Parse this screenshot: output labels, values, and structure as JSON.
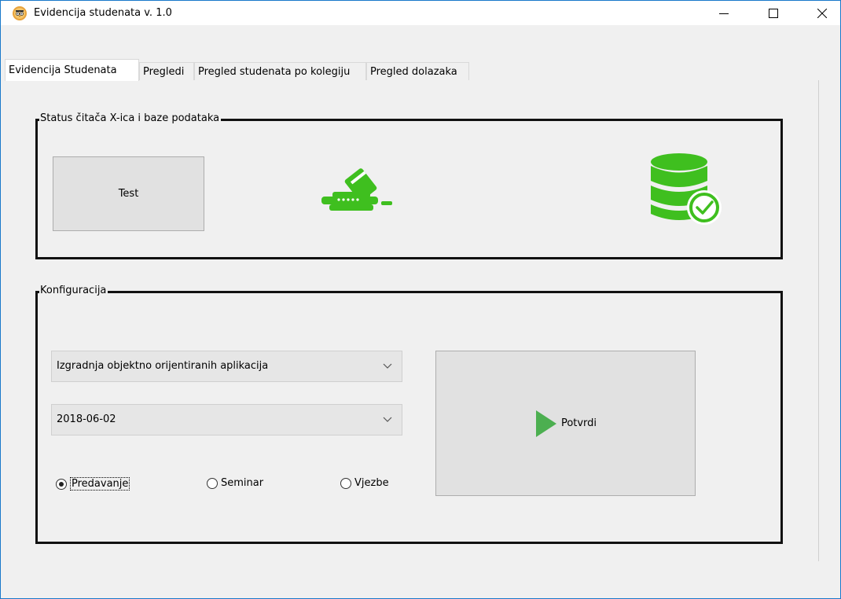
{
  "window": {
    "title": "Evidencija studenata v. 1.0",
    "icon": "owl-icon",
    "controls": [
      "minimize-icon",
      "maximize-icon",
      "close-icon"
    ]
  },
  "tabs": [
    {
      "label": "Evidencija Studenata",
      "active": true
    },
    {
      "label": "Pregledi",
      "active": false
    },
    {
      "label": "Pregled studenata po kolegiju",
      "active": false
    },
    {
      "label": "Pregled dolazaka",
      "active": false
    }
  ],
  "status_group": {
    "title": "Status čitača X-ica i baze podataka",
    "test_button": "Test",
    "reader_icon": "card-reader-icon",
    "database_icon": "database-check-icon",
    "status_color": "#3fbf1f"
  },
  "config_group": {
    "title": "Konfiguracija",
    "course_select": "Izgradnja objektno orijentiranih aplikacija",
    "date_select": "2018-06-02",
    "radios": [
      {
        "label": "Predavanje",
        "checked": true
      },
      {
        "label": "Seminar",
        "checked": false
      },
      {
        "label": "Vjezbe",
        "checked": false
      }
    ],
    "confirm_button": "Potvrdi",
    "confirm_icon": "play-icon",
    "confirm_icon_color": "#4caf50"
  }
}
